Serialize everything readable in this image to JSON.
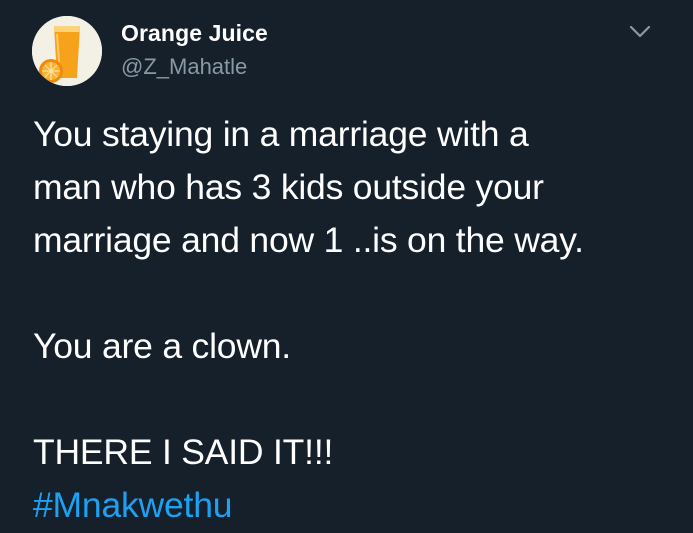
{
  "author": {
    "display_name": "Orange Juice",
    "handle": "@Z_Mahatle",
    "avatar_icon": "orange-juice-glass-icon"
  },
  "menu": {
    "icon": "chevron-down-icon"
  },
  "tweet": {
    "lines": [
      "You staying in a marriage with a",
      "man who has 3 kids outside your",
      "marriage and now 1 ..is on the way.",
      "You are a clown.",
      "THERE I SAID IT!!!"
    ],
    "hashtag": "#Mnakwethu"
  },
  "colors": {
    "background": "#15202b",
    "text": "#ffffff",
    "secondary_text": "#8899a6",
    "link": "#1da1f2"
  }
}
